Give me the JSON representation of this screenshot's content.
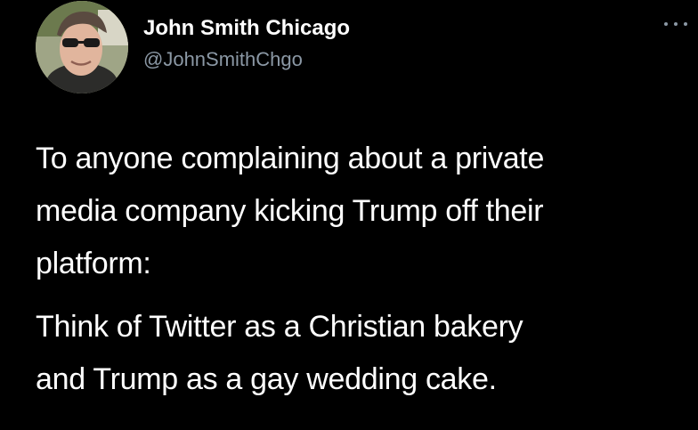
{
  "tweet": {
    "author": {
      "display_name": "John Smith Chicago",
      "handle": "@JohnSmithChgo",
      "avatar_icon": "profile-photo-man-sunglasses-cap"
    },
    "more_icon": "ellipsis-icon",
    "paragraphs": [
      {
        "lines": [
          "To anyone complaining about a private",
          "media company kicking Trump off their",
          "platform:"
        ]
      },
      {
        "lines": [
          "Think of Twitter as a Christian bakery",
          "and Trump as a gay wedding cake."
        ]
      }
    ]
  },
  "colors": {
    "background": "#000000",
    "text": "#ffffff",
    "secondary_text": "#8b98a5"
  }
}
